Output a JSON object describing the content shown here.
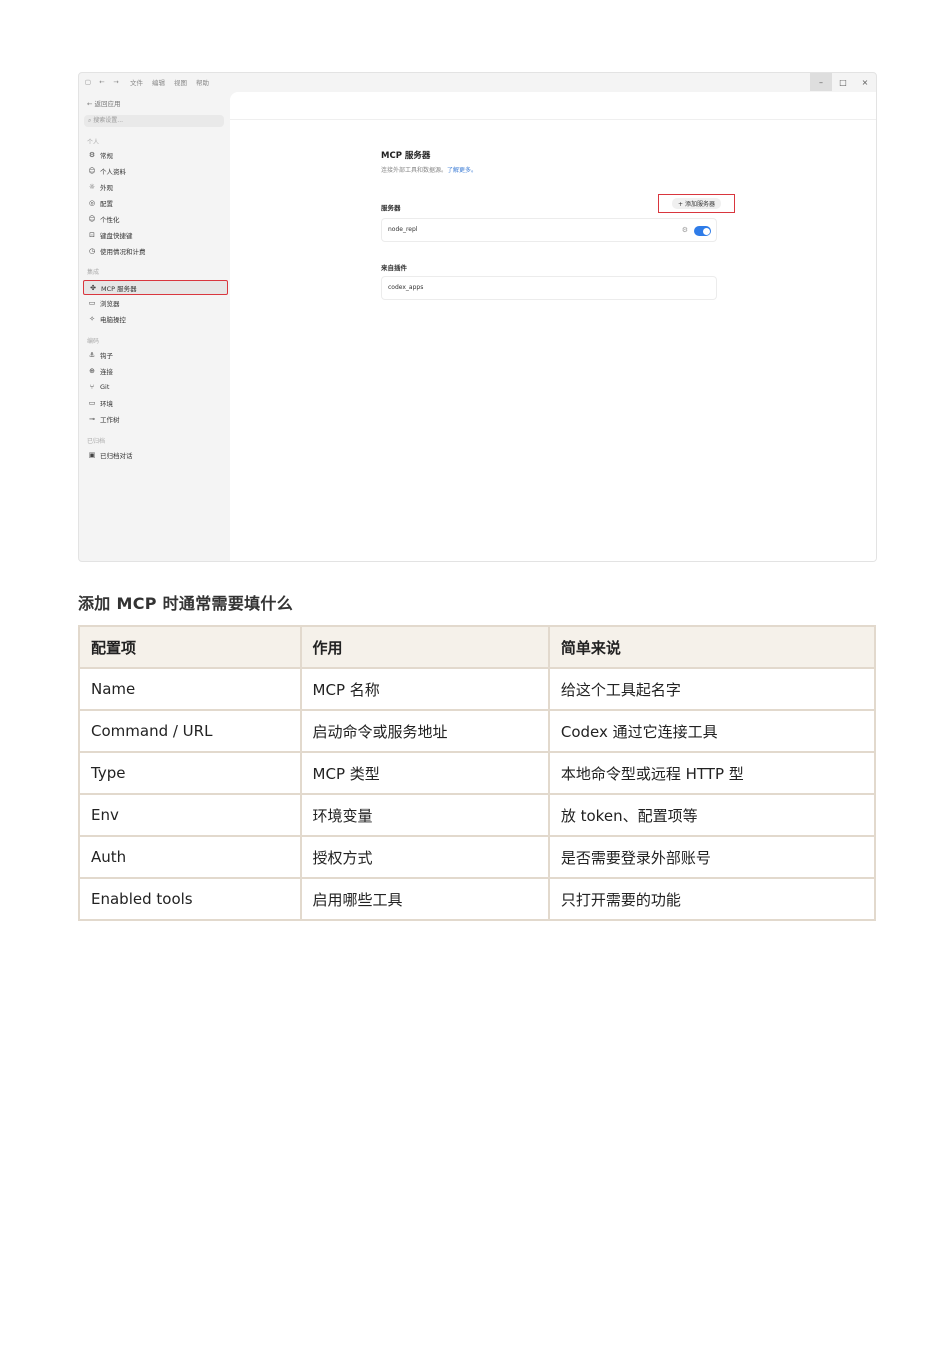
{
  "screenshot": {
    "titlebar": {
      "menu": [
        "文件",
        "编辑",
        "视图",
        "帮助"
      ],
      "window_controls": [
        "–",
        "□",
        "×"
      ]
    },
    "sidebar": {
      "back_label": "返回应用",
      "search_placeholder": "搜索设置...",
      "sections": [
        "个人",
        "集成",
        "编码",
        "已归档"
      ],
      "personal_items": [
        {
          "icon": "gear-icon",
          "label": "常规"
        },
        {
          "icon": "user-icon",
          "label": "个人资料"
        },
        {
          "icon": "sun-icon",
          "label": "外观"
        },
        {
          "icon": "config-icon",
          "label": "配置"
        },
        {
          "icon": "smile-icon",
          "label": "个性化"
        },
        {
          "icon": "keyboard-icon",
          "label": "键盘快捷键"
        },
        {
          "icon": "gauge-icon",
          "label": "使用情况和计费"
        }
      ],
      "integration_items": [
        {
          "icon": "mcp-icon",
          "label": "MCP 服务器",
          "selected": true
        },
        {
          "icon": "browser-icon",
          "label": "浏览器"
        },
        {
          "icon": "sparkle-icon",
          "label": "电脑操控"
        }
      ],
      "coding_items": [
        {
          "icon": "anchor-icon",
          "label": "钩子"
        },
        {
          "icon": "globe-icon",
          "label": "连接"
        },
        {
          "icon": "git-branch-icon",
          "label": "Git"
        },
        {
          "icon": "monitor-icon",
          "label": "环境"
        },
        {
          "icon": "worktree-icon",
          "label": "工作树"
        }
      ],
      "archived_items": [
        {
          "icon": "archive-icon",
          "label": "已归档对话"
        }
      ]
    },
    "content": {
      "title": "MCP 服务器",
      "description": "连接外部工具和数据源。",
      "learn_more": "了解更多。",
      "servers_label": "服务器",
      "add_button": "+ 添加服务器",
      "servers": [
        {
          "name": "node_repl",
          "enabled": true
        }
      ],
      "plugins_label": "来自插件",
      "plugins": [
        {
          "name": "codex_apps"
        }
      ]
    },
    "colors": {
      "highlight": "#d9363e",
      "toggle": "#2f7ce8",
      "link": "#3a7bd5"
    }
  },
  "document": {
    "heading": "添加 MCP 时通常需要填什么",
    "table": {
      "headers": [
        "配置项",
        "作用",
        "简单来说"
      ],
      "rows": [
        [
          "Name",
          "MCP 名称",
          "给这个工具起名字"
        ],
        [
          "Command / URL",
          "启动命令或服务地址",
          "Codex 通过它连接工具"
        ],
        [
          "Type",
          "MCP 类型",
          "本地命令型或远程 HTTP 型"
        ],
        [
          "Env",
          "环境变量",
          "放 token、配置项等"
        ],
        [
          "Auth",
          "授权方式",
          "是否需要登录外部账号"
        ],
        [
          "Enabled tools",
          "启用哪些工具",
          "只打开需要的功能"
        ]
      ]
    }
  }
}
